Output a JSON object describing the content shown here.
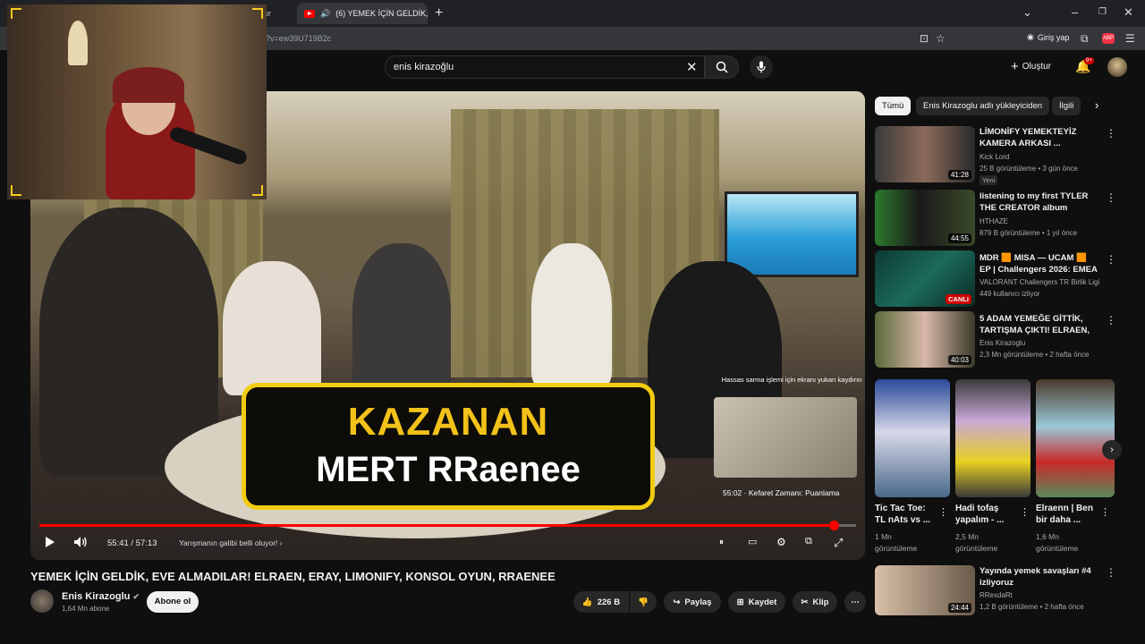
{
  "browser": {
    "prev_tab_label": "nur",
    "active_tab_label": "(6) YEMEK İÇİN GELDİK, EVE",
    "url_fragment": "h?v=ew39U719B2c",
    "signin_label": "Giriş yap",
    "extension_badge": "ABP"
  },
  "header": {
    "search_value": "enis kirazoğlu",
    "create_label": "Oluştur",
    "notification_count": "9+"
  },
  "player": {
    "banner_line1": "KAZANAN",
    "banner_line2": "MERT RRaenee",
    "pip_note": "Hassas sarma işlemi için ekranı yukarı kaydırın",
    "chapter_hover": "55:02 · Kefaret Zamanı: Puanlama",
    "time_current": "55:41",
    "time_sep": " / ",
    "time_total": "57:13",
    "chapter_pill": "Yarışmanın galibi belli oluyor!",
    "progress_fraction": 0.973
  },
  "video": {
    "title": "YEMEK İÇİN GELDİK, EVE ALMADILAR! ELRAEN, ERAY, LIMONIFY, KONSOL OYUN, RRAENEE",
    "channel": "Enis Kirazoglu",
    "subscribers": "1,64 Mn abone",
    "subscribe_label": "Abone ol",
    "likes": "226 B",
    "share_label": "Paylaş",
    "save_label": "Kaydet",
    "clip_label": "Klip"
  },
  "chips": [
    "Tümü",
    "Enis Kirazoglu adlı yükleyiciden",
    "İlgili"
  ],
  "recommendations": [
    {
      "title": "LİMONİFY YEMEKTEYİZ KAMERA ARKASI ...",
      "channel": "Kick Lord",
      "meta": "25 B görüntüleme • 3 gün önce",
      "duration": "41:28",
      "badge": "Yeni"
    },
    {
      "title": "listening to my first TYLER THE CREATOR album",
      "channel": "HTHAZE",
      "meta": "879 B görüntüleme • 1 yıl önce",
      "duration": "44:55",
      "badge": ""
    },
    {
      "title": "MDR 🟧 MISA — UCAM 🟧 EP | Challengers 2026: EMEA Stag...",
      "channel": "VALORANT Challengers TR Birlik Ligi",
      "meta": "449 kullanıcı izliyor",
      "duration": "CANLI",
      "badge": ""
    },
    {
      "title": "5 ADAM YEMEĞE GİTTİK, TARTIŞMA ÇIKTI! ELRAEN, ...",
      "channel": "Enis Kirazoglu",
      "meta": "2,3 Mn görüntüleme • 2 hafta önce",
      "duration": "40:03",
      "badge": ""
    },
    {
      "title": "Yayında yemek savaşları #4 izliyoruz",
      "channel": "RRexdaRt",
      "meta": "1,2 B görüntüleme • 2 hafta önce",
      "duration": "24:44",
      "badge": ""
    }
  ],
  "shorts": [
    {
      "title": "Tic Tac Toe: TL nAts vs ...",
      "views": "1 Mn görüntüleme"
    },
    {
      "title": "Hadi tofaş yapalım - ...",
      "views": "2,5 Mn görüntüleme"
    },
    {
      "title": "Elraenn | Ben bir daha ...",
      "views": "1,6 Mn görüntüleme"
    }
  ],
  "colors": {
    "accent": "#ff0000",
    "banner_gold": "#f2c21a",
    "background": "#0f0f0f"
  }
}
